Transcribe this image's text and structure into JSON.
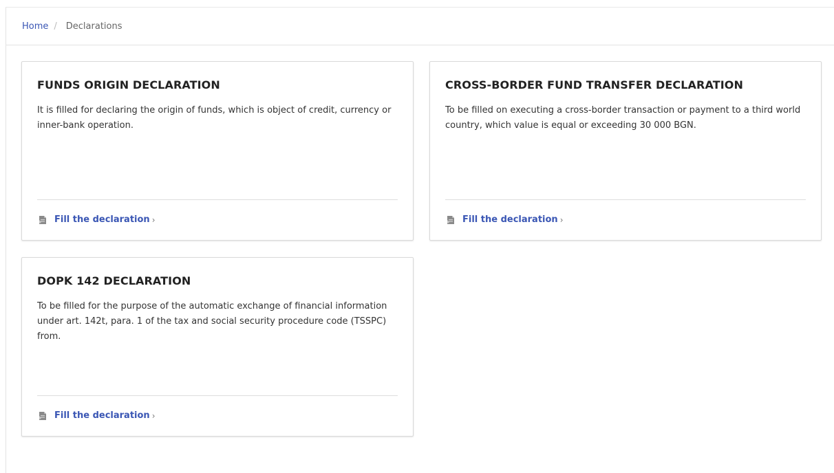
{
  "breadcrumb": {
    "home": "Home",
    "separator": "/",
    "current": "Declarations"
  },
  "cards": [
    {
      "title": "FUNDS ORIGIN DECLARATION",
      "description": "It is filled for declaring the origin of funds, which is object of credit, currency or inner-bank operation.",
      "action_label": "Fill the declaration",
      "action_chevron": "›"
    },
    {
      "title": "CROSS-BORDER FUND TRANSFER DECLARATION",
      "description": "To be filled on executing a cross-border transaction or payment to a third world country, which value is equal or exceeding 30 000 BGN.",
      "action_label": "Fill the declaration",
      "action_chevron": "›"
    },
    {
      "title": "DOPK 142 DECLARATION",
      "description": "To be filled for the purpose of the automatic exchange of financial information under art. 142t, para. 1 of the tax and social security procedure code (TSSPC) from.",
      "action_label": "Fill the declaration",
      "action_chevron": "›"
    }
  ],
  "colors": {
    "link": "#3a56b4",
    "text": "#333333",
    "border": "#d9d9d9",
    "icon": "#8a8a8a"
  },
  "icons": {
    "action": "document-icon"
  }
}
